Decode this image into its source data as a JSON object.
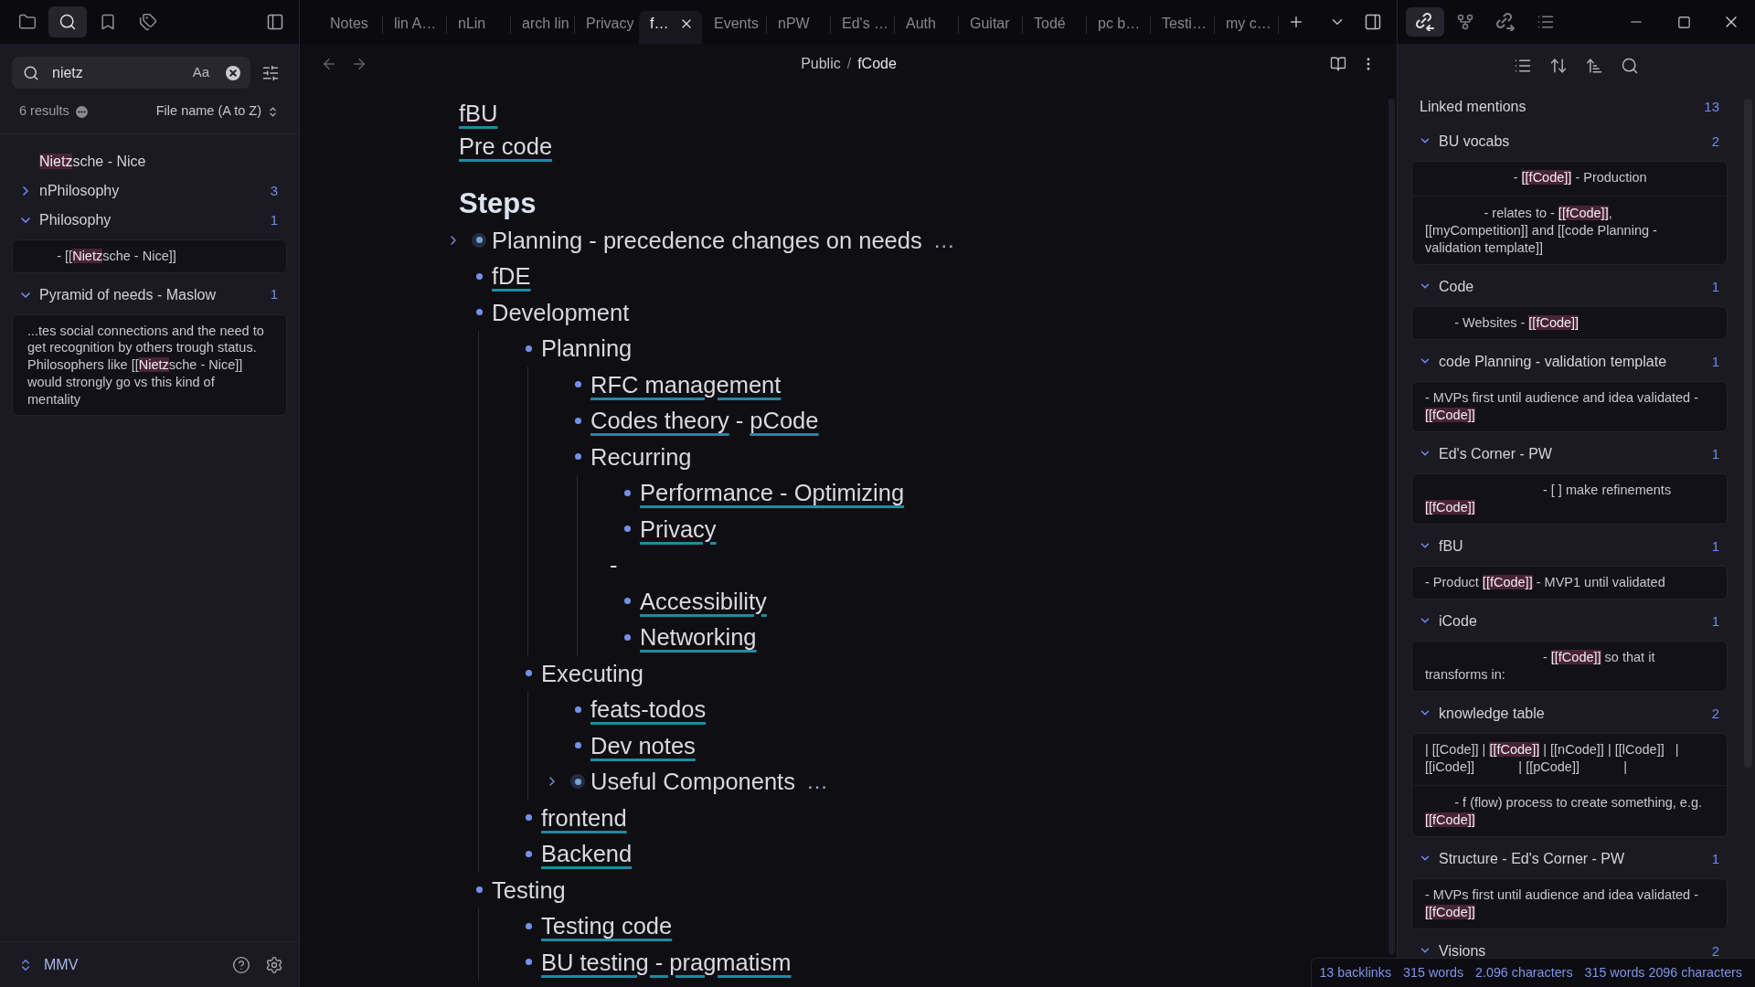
{
  "sidebar": {
    "tabs": [
      {
        "kind": "files",
        "selected": false
      },
      {
        "kind": "search",
        "selected": true
      },
      {
        "kind": "bookmarks",
        "selected": false
      },
      {
        "kind": "tags",
        "selected": false
      }
    ],
    "search": {
      "value": "nietz",
      "match_case": "Aa"
    },
    "results_count": "6 results",
    "sort": "File name (A to Z)",
    "results": [
      {
        "kind": "file",
        "title": [
          {
            "text": "Nietz",
            "match": true
          },
          {
            "text": "sche - Nice",
            "match": false
          }
        ]
      },
      {
        "kind": "group",
        "title": [
          {
            "text": "nPhilosophy",
            "match": false
          }
        ],
        "count": "3",
        "expanded": false
      },
      {
        "kind": "group",
        "title": [
          {
            "text": "Philosophy",
            "match": false
          }
        ],
        "count": "1",
        "expanded": true,
        "snippets": [
          [
            {
              "text": "\t- [[",
              "match": false
            },
            {
              "text": "Nietz",
              "match": true
            },
            {
              "text": "sche - Nice]]",
              "match": false
            }
          ]
        ]
      },
      {
        "kind": "group",
        "title": [
          {
            "text": "Pyramid of needs - Maslow",
            "match": false
          }
        ],
        "count": "1",
        "expanded": true,
        "snippets": [
          [
            {
              "text": "...tes social connections and the need to get recognition by others trough status. Philosophers like [[",
              "match": false
            },
            {
              "text": "Nietz",
              "match": true
            },
            {
              "text": "sche - Nice]] would strongly go vs this kind of mentality",
              "match": false
            }
          ]
        ]
      }
    ],
    "vault": "MMV"
  },
  "tab_bar": {
    "tabs": [
      {
        "label": "Notes",
        "selected": false
      },
      {
        "label": "lin A…",
        "selected": false
      },
      {
        "label": "nLin",
        "selected": false
      },
      {
        "label": "arch lin",
        "selected": false
      },
      {
        "label": "Privacy",
        "selected": false
      },
      {
        "label": "f…",
        "selected": true
      },
      {
        "label": "Events",
        "selected": false
      },
      {
        "label": "nPW",
        "selected": false
      },
      {
        "label": "Ed's …",
        "selected": false
      },
      {
        "label": "Auth",
        "selected": false
      },
      {
        "label": "Guitar",
        "selected": false
      },
      {
        "label": "Todé",
        "selected": false
      },
      {
        "label": "pc b…",
        "selected": false
      },
      {
        "label": "Testi…",
        "selected": false
      },
      {
        "label": "my c…",
        "selected": false
      }
    ]
  },
  "editor": {
    "breadcrumb": {
      "folder": "Public",
      "separator": "/",
      "file": "fCode"
    },
    "top_links": [
      "fBU",
      "Pre code"
    ],
    "heading": "Steps",
    "outline": [
      {
        "kind": "bullet",
        "parts": [
          {
            "text": "Planning - precedence changes on needs",
            "link": false
          }
        ],
        "folded": true,
        "fold_marker": "…"
      },
      {
        "kind": "bullet",
        "parts": [
          {
            "text": "fDE",
            "link": true
          }
        ],
        "folded": false
      },
      {
        "kind": "bullet",
        "parts": [
          {
            "text": "Development",
            "link": false
          }
        ],
        "folded": false,
        "children": [
          {
            "kind": "bullet",
            "parts": [
              {
                "text": "Planning",
                "link": false
              }
            ],
            "folded": false,
            "children": [
              {
                "kind": "bullet",
                "parts": [
                  {
                    "text": "RFC management",
                    "link": true
                  }
                ],
                "folded": false
              },
              {
                "kind": "bullet",
                "parts": [
                  {
                    "text": "Codes theory",
                    "link": true
                  },
                  {
                    "text": " - ",
                    "link": false
                  },
                  {
                    "text": "pCode",
                    "link": true
                  }
                ],
                "folded": false
              },
              {
                "kind": "bullet",
                "parts": [
                  {
                    "text": "Recurring",
                    "link": false
                  }
                ],
                "folded": false,
                "children": [
                  {
                    "kind": "bullet",
                    "parts": [
                      {
                        "text": "Performance - Optimizing",
                        "link": true
                      }
                    ],
                    "folded": false
                  },
                  {
                    "kind": "bullet",
                    "parts": [
                      {
                        "text": "Privacy",
                        "link": true
                      }
                    ],
                    "folded": false
                  },
                  {
                    "kind": "text",
                    "parts": [
                      {
                        "text": "-",
                        "link": false
                      }
                    ]
                  },
                  {
                    "kind": "bullet",
                    "parts": [
                      {
                        "text": "Accessibility",
                        "link": true
                      }
                    ],
                    "folded": false
                  },
                  {
                    "kind": "bullet",
                    "parts": [
                      {
                        "text": "Networking",
                        "link": true
                      }
                    ],
                    "folded": false
                  }
                ]
              }
            ]
          },
          {
            "kind": "bullet",
            "parts": [
              {
                "text": "Executing",
                "link": false
              }
            ],
            "folded": false,
            "children": [
              {
                "kind": "bullet",
                "parts": [
                  {
                    "text": "feats-todos",
                    "link": true
                  }
                ],
                "folded": false
              },
              {
                "kind": "bullet",
                "parts": [
                  {
                    "text": "Dev notes",
                    "link": true
                  }
                ],
                "folded": false
              },
              {
                "kind": "bullet",
                "parts": [
                  {
                    "text": "Useful Components",
                    "link": false
                  }
                ],
                "folded": true,
                "fold_marker": "…"
              }
            ]
          },
          {
            "kind": "bullet",
            "parts": [
              {
                "text": "frontend",
                "link": true
              }
            ],
            "folded": false
          },
          {
            "kind": "bullet",
            "parts": [
              {
                "text": "Backend",
                "link": true
              }
            ],
            "folded": false
          }
        ]
      },
      {
        "kind": "bullet",
        "parts": [
          {
            "text": "Testing",
            "link": false
          }
        ],
        "folded": false,
        "children": [
          {
            "kind": "bullet",
            "parts": [
              {
                "text": "Testing code",
                "link": true
              }
            ],
            "folded": false
          },
          {
            "kind": "bullet",
            "parts": [
              {
                "text": "BU testing - pragmatism",
                "link": true
              }
            ],
            "folded": false
          }
        ]
      }
    ]
  },
  "right_panel": {
    "tabs": [
      {
        "kind": "backlinks",
        "selected": true
      },
      {
        "kind": "graph",
        "selected": false
      },
      {
        "kind": "outgoing",
        "selected": false
      },
      {
        "kind": "outline",
        "selected": false
      }
    ],
    "backlinks": {
      "title": "Linked mentions",
      "count": "13",
      "groups": [
        {
          "title": "BU vocabs",
          "count": "2",
          "expanded": true,
          "snippets": [
            [
              {
                "text": "\t\t\t- ",
                "match": false
              },
              {
                "text": "[[fCode]]",
                "match": true
              },
              {
                "text": " - Production",
                "match": false
              }
            ],
            [
              {
                "text": "\t\t- relates to - ",
                "match": false
              },
              {
                "text": "[[fCode]]",
                "match": true
              },
              {
                "text": ", [[myCompetition]] and [[code Planning - validation template]]",
                "match": false
              }
            ]
          ]
        },
        {
          "title": "Code",
          "count": "1",
          "expanded": true,
          "snippets": [
            [
              {
                "text": "\t- Websites - ",
                "match": false
              },
              {
                "text": "[[fCode]]",
                "match": true
              }
            ]
          ]
        },
        {
          "title": "code Planning - validation template",
          "count": "1",
          "expanded": true,
          "snippets": [
            [
              {
                "text": "- MVPs first until audience and idea validated - ",
                "match": false
              },
              {
                "text": "[[fCode]]",
                "match": true
              }
            ]
          ]
        },
        {
          "title": "Ed's Corner - PW",
          "count": "1",
          "expanded": true,
          "snippets": [
            [
              {
                "text": "\t\t\t\t- [ ] make refinements ",
                "match": false
              },
              {
                "text": "[[fCode]]",
                "match": true
              }
            ]
          ]
        },
        {
          "title": "fBU",
          "count": "1",
          "expanded": true,
          "snippets": [
            [
              {
                "text": "- Product ",
                "match": false
              },
              {
                "text": "[[fCode]]",
                "match": true
              },
              {
                "text": " - MVP1 until validated",
                "match": false
              }
            ]
          ]
        },
        {
          "title": "iCode",
          "count": "1",
          "expanded": true,
          "snippets": [
            [
              {
                "text": "\t\t\t\t- ",
                "match": false
              },
              {
                "text": "[[fCode]]",
                "match": true
              },
              {
                "text": " so that it transforms in:",
                "match": false
              }
            ]
          ]
        },
        {
          "title": "knowledge table",
          "count": "2",
          "expanded": true,
          "snippets": [
            [
              {
                "text": "| [[Code]] | ",
                "match": false
              },
              {
                "text": "[[fCode]]",
                "match": true
              },
              {
                "text": " | [[nCode]] | [[lCode]]   | [[iCode]]            | [[pCode]]            |",
                "match": false
              }
            ],
            [
              {
                "text": "\t- f (flow) process to create something, e.g. ",
                "match": false
              },
              {
                "text": "[[fCode]]",
                "match": true
              }
            ]
          ]
        },
        {
          "title": "Structure - Ed's Corner - PW",
          "count": "1",
          "expanded": true,
          "snippets": [
            [
              {
                "text": "- MVPs first until audience and idea validated - ",
                "match": false
              },
              {
                "text": "[[fCode]]",
                "match": true
              }
            ]
          ]
        },
        {
          "title": "Visions",
          "count": "2",
          "expanded": true
        }
      ]
    }
  },
  "status_bar": [
    "13 backlinks",
    "315 words",
    "2.096 characters",
    "315 words 2096 characters"
  ]
}
